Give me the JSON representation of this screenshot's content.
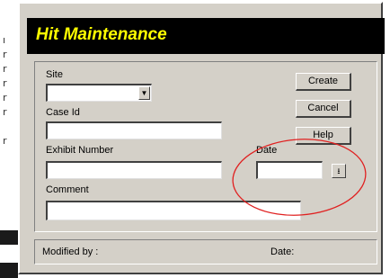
{
  "dialog": {
    "title": "Hit Maintenance"
  },
  "form": {
    "site_label": "Site",
    "site_value": "",
    "case_id_label": "Case Id",
    "case_id_value": "",
    "exhibit_number_label": "Exhibit Number",
    "exhibit_number_value": "",
    "date_label": "Date",
    "date_value": "",
    "comment_label": "Comment",
    "comment_value": ""
  },
  "buttons": {
    "create": "Create",
    "cancel": "Cancel",
    "help": "Help"
  },
  "status": {
    "modified_by_label": "Modified by :",
    "date_label": "Date:"
  },
  "background_glyphs": [
    "ı",
    "r",
    "r",
    "r",
    "r",
    "r",
    "r"
  ],
  "colors": {
    "title_text": "#ffff00",
    "title_bar": "#000000",
    "dialog_face": "#d4d0c8",
    "annotation_ellipse": "#e02020"
  },
  "icons": {
    "site_dropdown": "chevron-down-icon",
    "date_picker": "arrow-down-icon"
  }
}
